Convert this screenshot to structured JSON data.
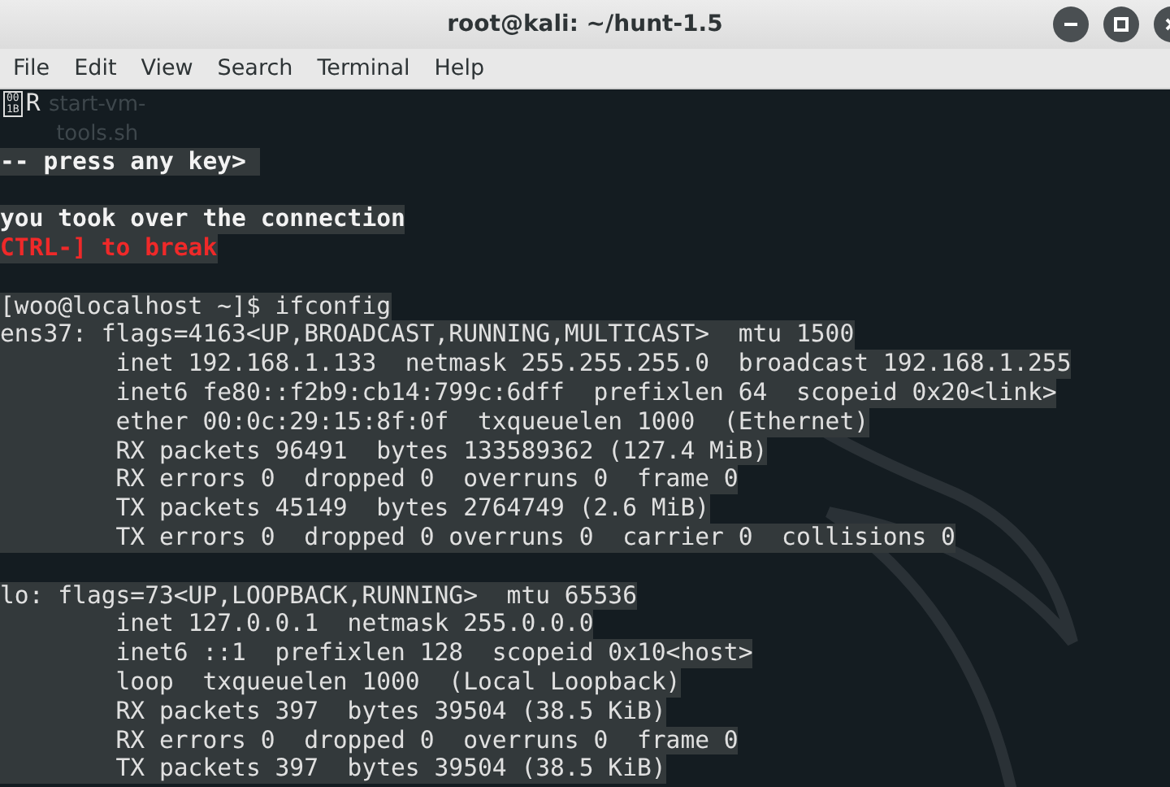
{
  "window": {
    "title": "root@kali: ~/hunt-1.5"
  },
  "menu": [
    "File",
    "Edit",
    "View",
    "Search",
    "Terminal",
    "Help"
  ],
  "desktop_label": [
    "start-vm-",
    "tools.sh"
  ],
  "terminal": {
    "lines": [
      {
        "kind": "glyph",
        "glyph": "001B",
        "text": "R",
        "highlighted": false
      },
      {
        "kind": "blank"
      },
      {
        "kind": "bold",
        "text": "-- press any key> ",
        "highlighted": true
      },
      {
        "kind": "blank"
      },
      {
        "kind": "bold",
        "text": "you took over the connection",
        "highlighted": true
      },
      {
        "kind": "error",
        "text": "CTRL-] to break",
        "highlighted": true
      },
      {
        "kind": "blank"
      },
      {
        "kind": "plain",
        "text": "[woo@localhost ~]$ ifconfig",
        "highlighted": true
      },
      {
        "kind": "plain",
        "text": "ens37: flags=4163<UP,BROADCAST,RUNNING,MULTICAST>  mtu 1500",
        "highlighted": true
      },
      {
        "kind": "plain",
        "text": "        inet 192.168.1.133  netmask 255.255.255.0  broadcast 192.168.1.255",
        "highlighted": true
      },
      {
        "kind": "plain",
        "text": "        inet6 fe80::f2b9:cb14:799c:6dff  prefixlen 64  scopeid 0x20<link>",
        "highlighted": true
      },
      {
        "kind": "plain",
        "text": "        ether 00:0c:29:15:8f:0f  txqueuelen 1000  (Ethernet)",
        "highlighted": true
      },
      {
        "kind": "plain",
        "text": "        RX packets 96491  bytes 133589362 (127.4 MiB)",
        "highlighted": true
      },
      {
        "kind": "plain",
        "text": "        RX errors 0  dropped 0  overruns 0  frame 0",
        "highlighted": true
      },
      {
        "kind": "plain",
        "text": "        TX packets 45149  bytes 2764749 (2.6 MiB)",
        "highlighted": true
      },
      {
        "kind": "plain",
        "text": "        TX errors 0  dropped 0 overruns 0  carrier 0  collisions 0",
        "highlighted": true
      },
      {
        "kind": "blank"
      },
      {
        "kind": "plain",
        "text": "lo: flags=73<UP,LOOPBACK,RUNNING>  mtu 65536",
        "highlighted": true
      },
      {
        "kind": "plain",
        "text": "        inet 127.0.0.1  netmask 255.0.0.0",
        "highlighted": true
      },
      {
        "kind": "plain",
        "text": "        inet6 ::1  prefixlen 128  scopeid 0x10<host>",
        "highlighted": true
      },
      {
        "kind": "plain",
        "text": "        loop  txqueuelen 1000  (Local Loopback)",
        "highlighted": true
      },
      {
        "kind": "plain",
        "text": "        RX packets 397  bytes 39504 (38.5 KiB)",
        "highlighted": true
      },
      {
        "kind": "plain",
        "text": "        RX errors 0  dropped 0  overruns 0  frame 0",
        "highlighted": true
      },
      {
        "kind": "plain",
        "text": "        TX packets 397  bytes 39504 (38.5 KiB)",
        "highlighted": true
      }
    ]
  }
}
